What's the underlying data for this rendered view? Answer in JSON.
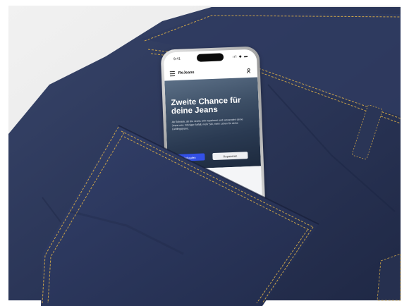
{
  "status_bar": {
    "time": "9:41",
    "icons": "ııl ◆ ▬"
  },
  "app": {
    "title": "ReJeans"
  },
  "hero": {
    "title": "Zweite Chance für deine Jeans",
    "text": "Ab Schrank, ab die Jeans. Wir reparieren und verwenden deine Jeans neu. Weniger Abfall, mehr Stil, mehr Leben für deine Lieblingsjeans.",
    "primary_button": "Verkaufen",
    "secondary_button": "Reparieren"
  },
  "colors": {
    "denim": "#2b3550",
    "stitch": "#c9a24a",
    "accent": "#3350e6",
    "background": "#ececec"
  }
}
